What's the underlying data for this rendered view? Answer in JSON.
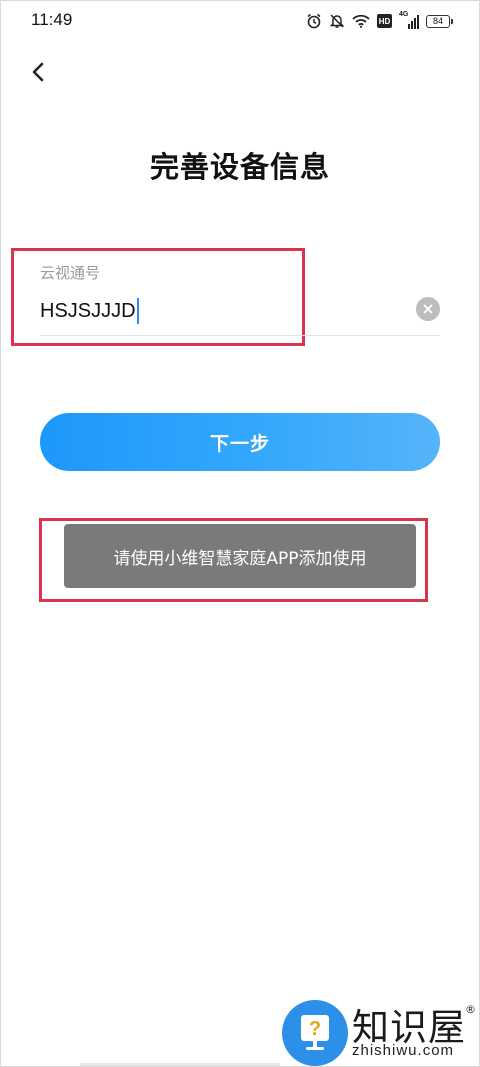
{
  "status_bar": {
    "time": "11:49",
    "network_label": "4G",
    "hd_label": "HD",
    "battery_level": "84",
    "icons": [
      "alarm-icon",
      "mute-icon",
      "wifi-icon",
      "hd-icon",
      "signal-icon",
      "battery-icon"
    ]
  },
  "header": {
    "back_icon": "chevron-left-icon",
    "title": "完善设备信息"
  },
  "form": {
    "field_label": "云视通号",
    "field_value": "HSJSJJJD",
    "clear_icon": "clear-icon"
  },
  "next_button": {
    "label": "下一步"
  },
  "toast": {
    "message": "请使用小维智慧家庭APP添加使用"
  },
  "watermark": {
    "brand_cn": "知识屋",
    "registered": "®",
    "domain": "zhishiwu.com",
    "icon": "question-monitor-icon"
  },
  "colors": {
    "accent": "#1c98fb",
    "annotation": "#d8344d",
    "toast_bg": "#7a7a7a",
    "watermark_blue": "#2c8fe8"
  }
}
